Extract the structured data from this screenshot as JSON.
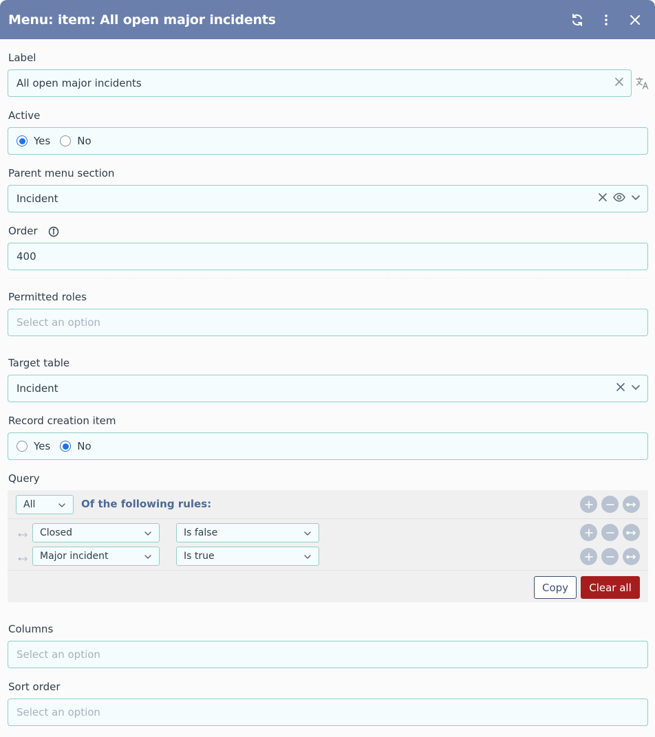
{
  "header": {
    "title": "Menu: item: All open major incidents"
  },
  "label_field": {
    "label": "Label",
    "value": "All open major incidents"
  },
  "active_field": {
    "label": "Active",
    "options": [
      "Yes",
      "No"
    ],
    "selected": "Yes"
  },
  "parent_section": {
    "label": "Parent menu section",
    "value": "Incident"
  },
  "order_field": {
    "label": "Order",
    "value": "400"
  },
  "permitted_roles": {
    "label": "Permitted roles",
    "placeholder": "Select an option"
  },
  "target_table": {
    "label": "Target table",
    "value": "Incident"
  },
  "record_creation": {
    "label": "Record creation item",
    "options": [
      "Yes",
      "No"
    ],
    "selected": "No"
  },
  "query": {
    "label": "Query",
    "match_select": "All",
    "rules_label": "Of the following rules:",
    "rules": [
      {
        "field": "Closed",
        "condition": "Is false"
      },
      {
        "field": "Major incident",
        "condition": "Is true"
      }
    ],
    "copy_label": "Copy",
    "clear_label": "Clear all"
  },
  "columns": {
    "label": "Columns",
    "placeholder": "Select an option"
  },
  "sort_order": {
    "label": "Sort order",
    "placeholder": "Select an option"
  },
  "colors": {
    "header_bg": "#6a7fab",
    "accent_border": "#8fd0c7",
    "danger": "#a61d1d",
    "radio_active": "#1e73e8"
  }
}
